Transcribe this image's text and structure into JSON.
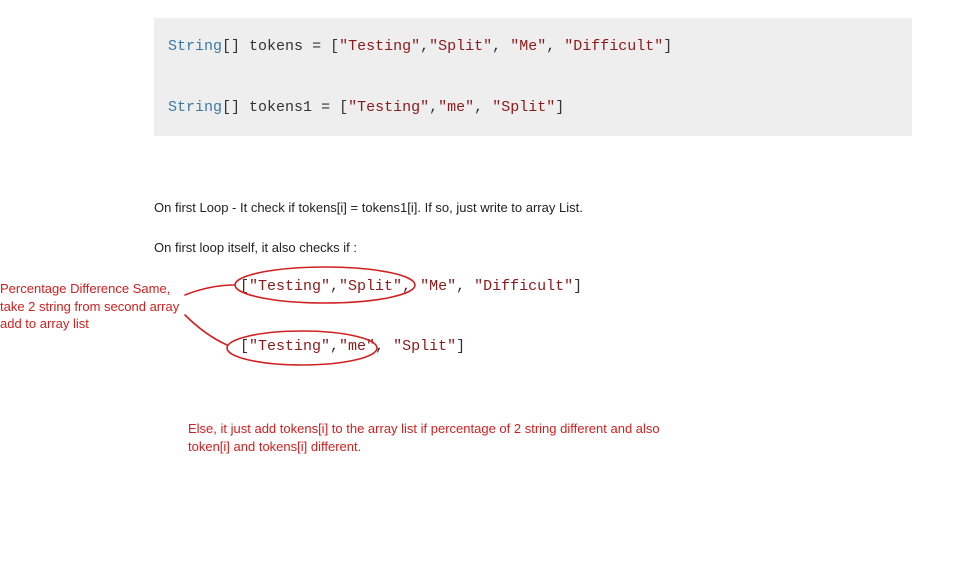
{
  "code_top": {
    "keyword1": "String",
    "brackets1": "[]",
    "var1": "tokens",
    "eq": "=",
    "arr1_open": "[",
    "arr1_v1": "\"Testing\"",
    "arr1_c1": ",",
    "arr1_v2": "\"Split\"",
    "arr1_c2": ", ",
    "arr1_v3": "\"Me\"",
    "arr1_c3": ", ",
    "arr1_v4": "\"Difficult\"",
    "arr1_close": "]",
    "keyword2": "String",
    "brackets2": "[]",
    "var2": "tokens1",
    "arr2_open": "[",
    "arr2_v1": "\"Testing\"",
    "arr2_c1": ",",
    "arr2_v2": "\"me\"",
    "arr2_c2": ", ",
    "arr2_v3": "\"Split\"",
    "arr2_close": "]"
  },
  "explain": {
    "line1": "On first Loop - It check if tokens[i] = tokens1[i]. If so, just write to array List.",
    "line2": "On first loop itself, it also checks if :"
  },
  "arrays": {
    "a1_open": "[",
    "a1_v1": "\"Testing\"",
    "a1_c1": ",",
    "a1_v2": "\"Split\"",
    "a1_c2": ", ",
    "a1_v3": "\"Me\"",
    "a1_c3": ", ",
    "a1_v4": "\"Difficult\"",
    "a1_close": "]",
    "a2_open": "[",
    "a2_v1": "\"Testing\"",
    "a2_c1": ",",
    "a2_v2": "\"me\"",
    "a2_c2": ", ",
    "a2_v3": "\"Split\"",
    "a2_close": "]"
  },
  "notes": {
    "left": "Percentage Difference Same, take 2 string from second array add to array list",
    "bottom": "Else, it just add tokens[i] to the array list  if percentage of 2 string different and also token[i] and tokens[i] different."
  }
}
